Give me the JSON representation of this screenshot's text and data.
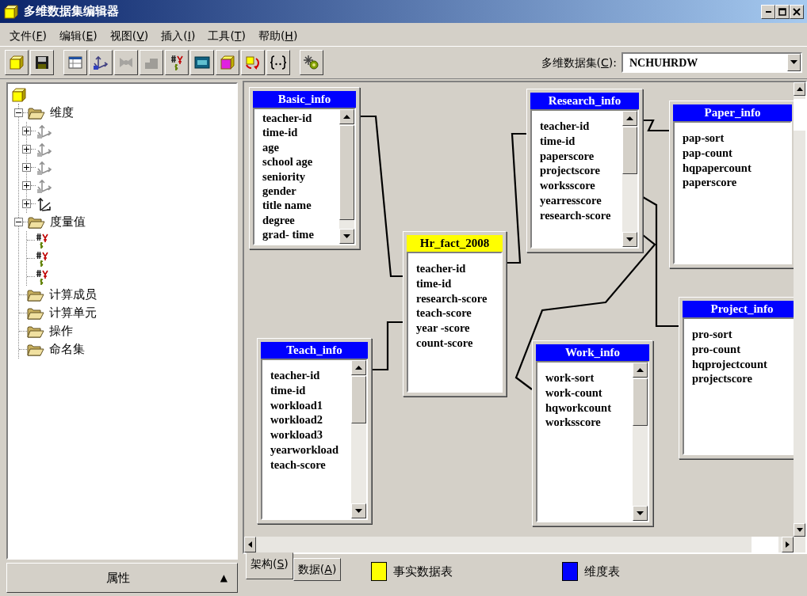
{
  "window": {
    "title": "多维数据集编辑器"
  },
  "menu": [
    "文件(F)",
    "编辑(E)",
    "视图(V)",
    "插入(I)",
    "工具(T)",
    "帮助(H)"
  ],
  "toolbar": [
    {
      "disabled": false
    },
    {
      "disabled": false
    },
    {
      "disabled": false
    },
    {
      "disabled": false
    },
    {
      "disabled": true
    },
    {
      "disabled": true
    },
    {
      "disabled": false
    },
    {
      "disabled": false
    },
    {
      "disabled": false
    },
    {
      "disabled": false
    },
    {
      "disabled": false
    },
    {
      "disabled": false
    }
  ],
  "cube_selector": {
    "label": "多维数据集(C):",
    "value": "NCHUHRDW"
  },
  "tree": [
    {
      "kind": "cube",
      "children": [
        {
          "kind": "folder",
          "label": "维度",
          "expanded": true,
          "children": [
            {
              "kind": "dimension",
              "expanded": false
            },
            {
              "kind": "dimension",
              "expanded": false
            },
            {
              "kind": "dimension",
              "expanded": false
            },
            {
              "kind": "dimension",
              "expanded": false
            },
            {
              "kind": "dimension-alt",
              "expanded": false
            }
          ]
        },
        {
          "kind": "folder",
          "label": "度量值",
          "expanded": true,
          "children": [
            {
              "kind": "measure"
            },
            {
              "kind": "measure"
            },
            {
              "kind": "measure"
            }
          ]
        },
        {
          "kind": "folder",
          "label": "计算成员"
        },
        {
          "kind": "folder",
          "label": "计算单元"
        },
        {
          "kind": "folder",
          "label": "操作"
        },
        {
          "kind": "folder",
          "label": "命名集"
        }
      ]
    }
  ],
  "properties_bar": {
    "label": "属性",
    "arrow": "▲"
  },
  "tables": [
    {
      "name": "Basic_info",
      "kind": "dimension",
      "scrollbar": true,
      "fields": [
        "teacher-id",
        "time-id",
        "age",
        "school age",
        "seniority",
        "gender",
        "title name",
        "degree",
        "grad- time"
      ]
    },
    {
      "name": "Research_info",
      "kind": "dimension",
      "scrollbar": true,
      "fields": [
        "teacher-id",
        "time-id",
        "paperscore",
        "projectscore",
        "worksscore",
        "yearresscore",
        "research-score"
      ]
    },
    {
      "name": "Paper_info",
      "kind": "dimension",
      "scrollbar": false,
      "fields": [
        "pap-sort",
        "pap-count",
        "hqpapercount",
        "paperscore"
      ]
    },
    {
      "name": "Hr_fact_2008",
      "kind": "fact",
      "scrollbar": false,
      "fields": [
        "teacher-id",
        "time-id",
        "research-score",
        "teach-score",
        "year -score",
        "count-score"
      ]
    },
    {
      "name": "Project_info",
      "kind": "dimension",
      "scrollbar": false,
      "fields": [
        "pro-sort",
        "pro-count",
        "hqprojectcount",
        "projectscore"
      ]
    },
    {
      "name": "Teach_info",
      "kind": "dimension",
      "scrollbar": true,
      "fields": [
        "teacher-id",
        "time-id",
        "workload1",
        "workload2",
        "workload3",
        "yearworkload",
        "teach-score"
      ]
    },
    {
      "name": "Work_info",
      "kind": "dimension",
      "scrollbar": true,
      "fields": [
        "work-sort",
        "work-count",
        "hqworkcount",
        "worksscore"
      ]
    }
  ],
  "tabs": [
    {
      "label": "架构(S)",
      "selected": true
    },
    {
      "label": "数据(A)",
      "selected": false
    }
  ],
  "legend": [
    {
      "label": "事实数据表",
      "color": "#ffff00"
    },
    {
      "label": "维度表",
      "color": "#0000ff"
    }
  ]
}
